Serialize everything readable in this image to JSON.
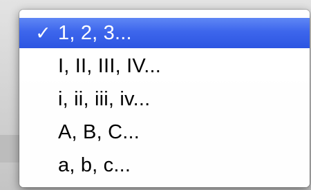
{
  "menu": {
    "items": [
      {
        "label": "1, 2, 3...",
        "selected": true,
        "check": "✓"
      },
      {
        "label": "I, II, III, IV...",
        "selected": false,
        "check": ""
      },
      {
        "label": "i, ii, iii, iv...",
        "selected": false,
        "check": ""
      },
      {
        "label": "A, B, C...",
        "selected": false,
        "check": ""
      },
      {
        "label": "a, b, c...",
        "selected": false,
        "check": ""
      }
    ]
  },
  "colors": {
    "selection": "#3d66ec",
    "menu_background": "#ffffff",
    "selected_text": "#ffffff",
    "text": "#000000"
  }
}
